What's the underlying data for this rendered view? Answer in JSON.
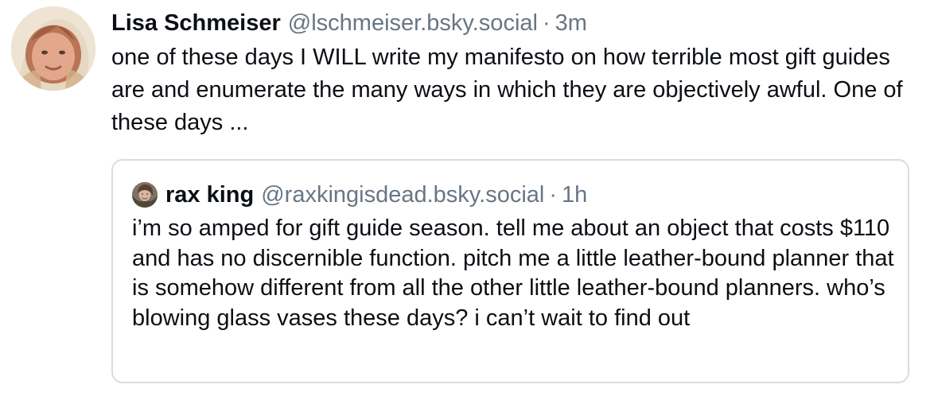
{
  "post": {
    "author": {
      "display_name": "Lisa Schmeiser",
      "handle": "@lschmeiser.bsky.social",
      "avatar_icon": "avatar-photo-icon"
    },
    "separator": "·",
    "timestamp": "3m",
    "text": "one of these days I WILL write my manifesto on how terrible most gift guides are and enumerate the many ways in which they are objectively awful. One of these days ..."
  },
  "quote": {
    "author": {
      "display_name": "rax king",
      "handle": "@raxkingisdead.bsky.social",
      "avatar_icon": "avatar-photo-icon"
    },
    "separator": "·",
    "timestamp": "1h",
    "text": "i’m so amped for gift guide season. tell me about an object that costs $110 and has no discernible function. pitch me a little leather-bound planner that is somehow different from all the other little leather-bound planners. who’s blowing glass vases these days? i can’t wait to find out"
  },
  "colors": {
    "text": "#0b0f14",
    "muted": "#687684",
    "border": "#d5dde5",
    "background": "#ffffff"
  }
}
